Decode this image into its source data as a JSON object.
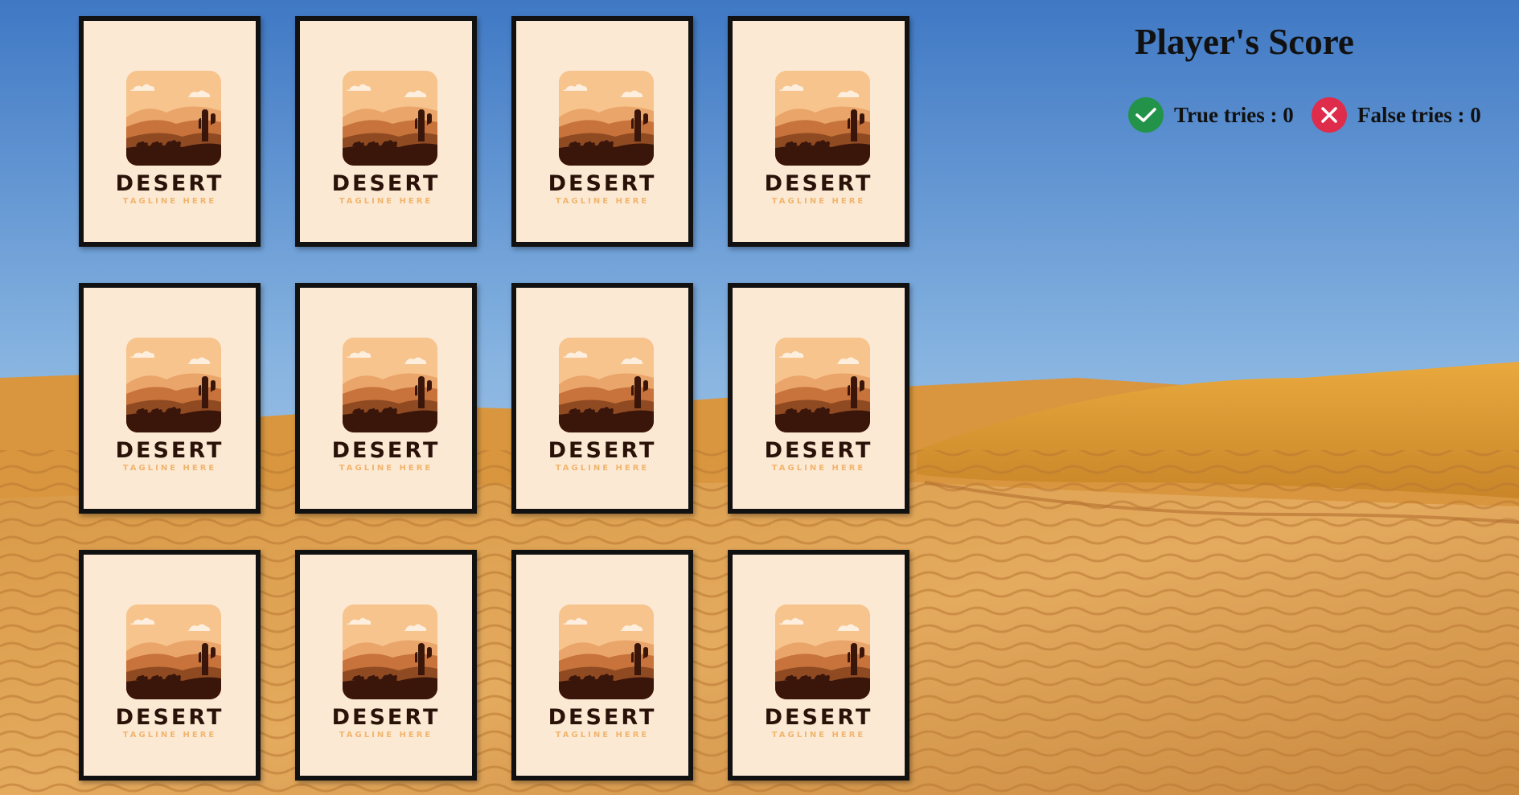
{
  "score": {
    "title": "Player's Score",
    "true_label": "True tries : 0",
    "false_label": "False tries : 0",
    "true_icon": "check-icon",
    "false_icon": "close-icon",
    "true_color": "#23934a",
    "false_color": "#de2c4a"
  },
  "cards": [
    {
      "title": "DESERT",
      "tagline": "TAGLINE HERE"
    },
    {
      "title": "DESERT",
      "tagline": "TAGLINE HERE"
    },
    {
      "title": "DESERT",
      "tagline": "TAGLINE HERE"
    },
    {
      "title": "DESERT",
      "tagline": "TAGLINE HERE"
    },
    {
      "title": "DESERT",
      "tagline": "TAGLINE HERE"
    },
    {
      "title": "DESERT",
      "tagline": "TAGLINE HERE"
    },
    {
      "title": "DESERT",
      "tagline": "TAGLINE HERE"
    },
    {
      "title": "DESERT",
      "tagline": "TAGLINE HERE"
    },
    {
      "title": "DESERT",
      "tagline": "TAGLINE HERE"
    },
    {
      "title": "DESERT",
      "tagline": "TAGLINE HERE"
    },
    {
      "title": "DESERT",
      "tagline": "TAGLINE HERE"
    },
    {
      "title": "DESERT",
      "tagline": "TAGLINE HERE"
    }
  ],
  "colors": {
    "card_face": "#fce9d4",
    "card_border": "#111111",
    "card_title": "#2a1208",
    "card_tagline": "#f0b56e"
  }
}
